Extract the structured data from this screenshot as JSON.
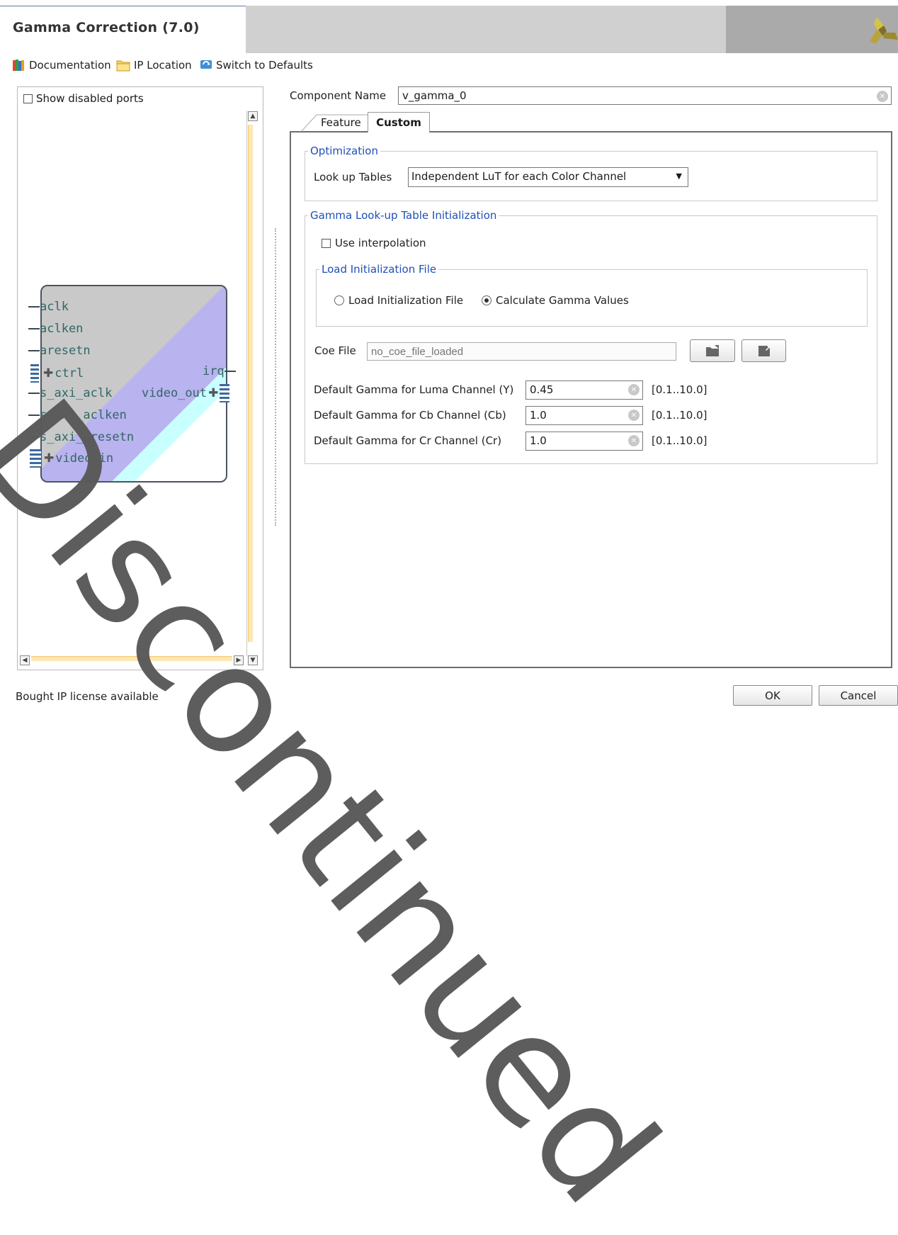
{
  "window": {
    "title": "Gamma Correction (7.0)"
  },
  "toolbar": {
    "documentation": "Documentation",
    "ip_location": "IP Location",
    "switch_defaults": "Switch to Defaults"
  },
  "left_panel": {
    "show_disabled_ports": "Show disabled ports",
    "ports_left": [
      "aclk",
      "aclken",
      "aresetn",
      "ctrl",
      "s_axi_aclk",
      "s_axi_aclken",
      "s_axi_aresetn",
      "video_in"
    ],
    "ports_right": [
      "irq",
      "video_out"
    ]
  },
  "component": {
    "label": "Component Name",
    "value": "v_gamma_0"
  },
  "tabs": [
    {
      "label": "Feature"
    },
    {
      "label": "Custom"
    }
  ],
  "optimization": {
    "legend": "Optimization",
    "lut_label": "Look up Tables",
    "lut_value": "Independent LuT for each Color Channel"
  },
  "gamma_lut": {
    "legend": "Gamma Look-up Table Initialization",
    "use_interpolation": "Use interpolation",
    "load_init_legend": "Load Initialization File",
    "radio_load": "Load Initialization File",
    "radio_calc": "Calculate Gamma Values",
    "coe_label": "Coe File",
    "coe_placeholder": "no_coe_file_loaded",
    "luma_label": "Default Gamma for Luma Channel (Y)",
    "luma_value": "0.45",
    "cb_label": "Default Gamma for Cb Channel (Cb)",
    "cb_value": "1.0",
    "cr_label": "Default Gamma for Cr Channel (Cr)",
    "cr_value": "1.0",
    "range": "[0.1..10.0]"
  },
  "footer": {
    "status": "Bought IP license available",
    "ok": "OK",
    "cancel": "Cancel"
  },
  "watermark": "Discontinued",
  "colors": {
    "legend_blue": "#1f4fb8",
    "header_gray": "#d0d0d0",
    "scroll_track": "#fce7b5",
    "block_purple": "#b9b3ef",
    "block_cyan": "#c8ffff"
  }
}
